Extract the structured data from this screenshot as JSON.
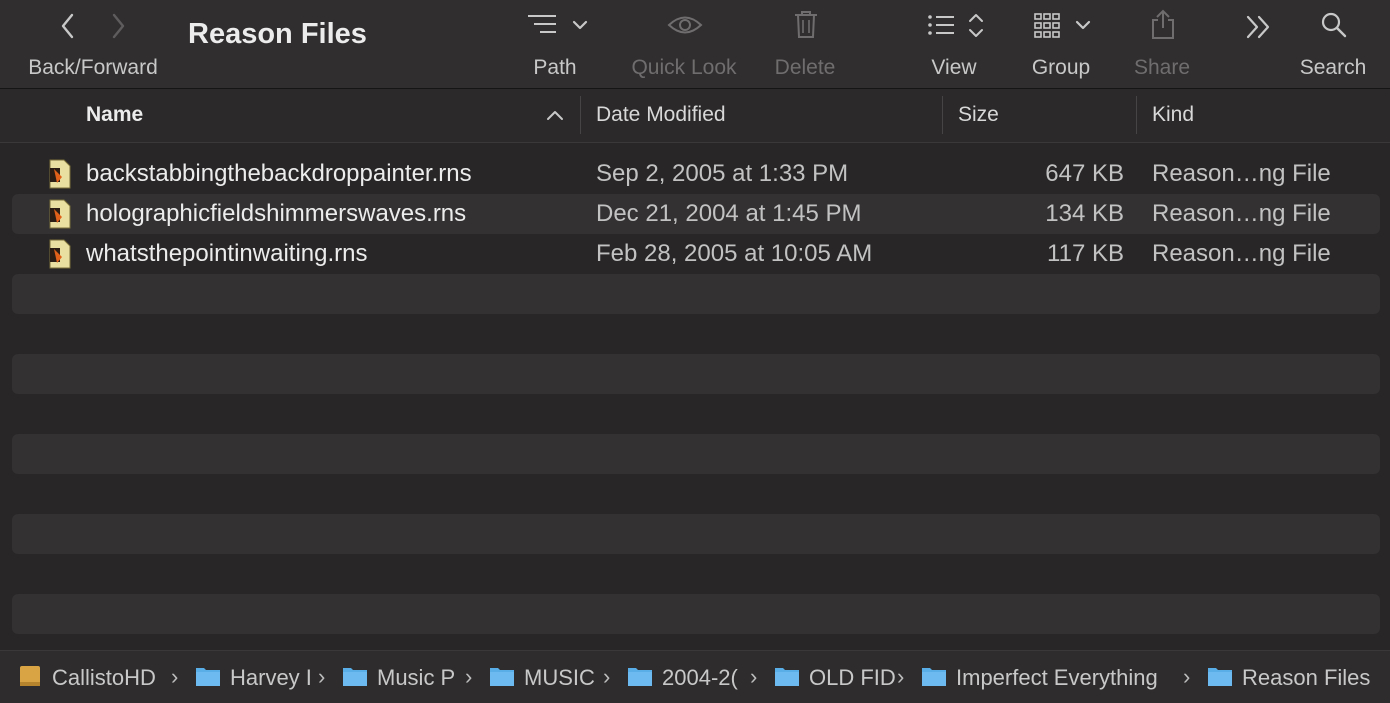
{
  "toolbar": {
    "title": "Reason Files",
    "back_forward_label": "Back/Forward",
    "path_label": "Path",
    "quick_look_label": "Quick Look",
    "delete_label": "Delete",
    "view_label": "View",
    "group_label": "Group",
    "share_label": "Share",
    "search_label": "Search"
  },
  "columns": {
    "name": "Name",
    "date": "Date Modified",
    "size": "Size",
    "kind": "Kind"
  },
  "files": [
    {
      "name": "backstabbingthebackdroppainter.rns",
      "date": "Sep 2, 2005 at 1:33 PM",
      "size": "647 KB",
      "kind": "Reason…ng File"
    },
    {
      "name": "holographicfieldshimmerswaves.rns",
      "date": "Dec 21, 2004 at 1:45 PM",
      "size": "134 KB",
      "kind": "Reason…ng File"
    },
    {
      "name": "whatsthepointinwaiting.rns",
      "date": "Feb 28, 2005 at 10:05 AM",
      "size": "117 KB",
      "kind": "Reason…ng File"
    }
  ],
  "path": [
    {
      "label": "CallistoHD",
      "icon": "drive-icon"
    },
    {
      "label": "Harvey I",
      "icon": "folder-icon"
    },
    {
      "label": "Music P",
      "icon": "folder-icon"
    },
    {
      "label": "MUSIC",
      "icon": "folder-icon"
    },
    {
      "label": "2004-2(",
      "icon": "folder-icon"
    },
    {
      "label": "OLD FID",
      "icon": "folder-icon"
    },
    {
      "label": "Imperfect Everything",
      "icon": "folder-icon"
    },
    {
      "label": "Reason Files",
      "icon": "folder-icon"
    }
  ],
  "colors": {
    "folder": "#5aaee8",
    "drive": "#d9a544"
  }
}
